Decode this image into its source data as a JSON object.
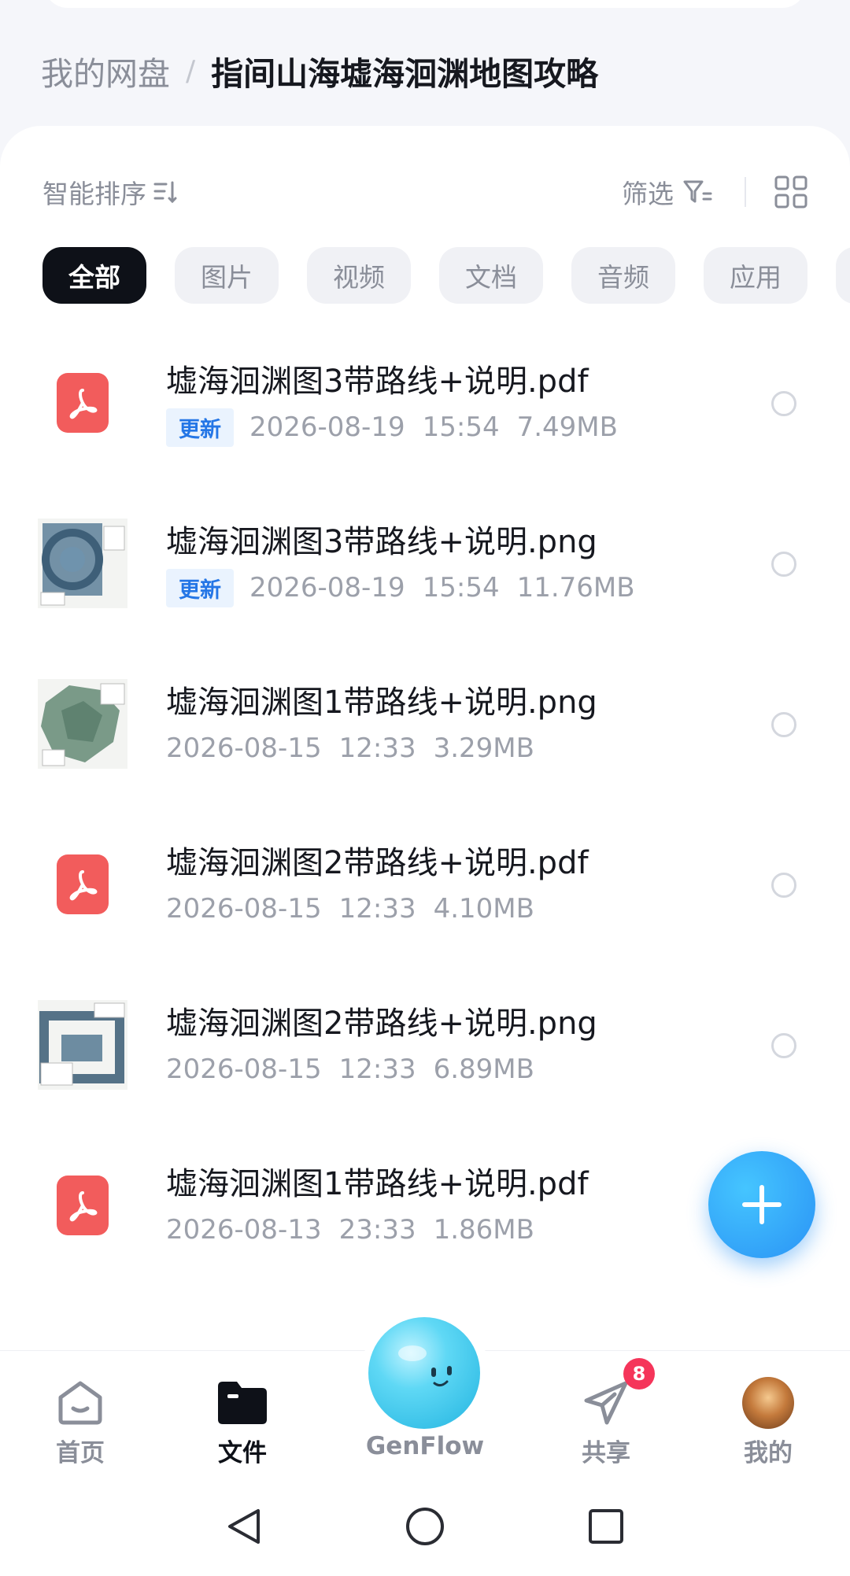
{
  "breadcrumb": {
    "root": "我的网盘",
    "separator": "/",
    "current": "指间山海墟海洄渊地图攻略"
  },
  "toolbar": {
    "sort_label": "智能排序",
    "filter_label": "筛选"
  },
  "tabs": [
    {
      "label": "全部",
      "active": true
    },
    {
      "label": "图片"
    },
    {
      "label": "视频"
    },
    {
      "label": "文档"
    },
    {
      "label": "音频"
    },
    {
      "label": "应用"
    }
  ],
  "files": [
    {
      "name": "墟海洄渊图3带路线+说明.pdf",
      "type": "pdf",
      "badge": "更新",
      "date": "2026-08-19",
      "time": "15:54",
      "size": "7.49MB"
    },
    {
      "name": "墟海洄渊图3带路线+说明.png",
      "type": "image",
      "badge": "更新",
      "date": "2026-08-19",
      "time": "15:54",
      "size": "11.76MB"
    },
    {
      "name": "墟海洄渊图1带路线+说明.png",
      "type": "image",
      "badge": "",
      "date": "2026-08-15",
      "time": "12:33",
      "size": "3.29MB"
    },
    {
      "name": "墟海洄渊图2带路线+说明.pdf",
      "type": "pdf",
      "badge": "",
      "date": "2026-08-15",
      "time": "12:33",
      "size": "4.10MB"
    },
    {
      "name": "墟海洄渊图2带路线+说明.png",
      "type": "image",
      "badge": "",
      "date": "2026-08-15",
      "time": "12:33",
      "size": "6.89MB"
    },
    {
      "name": "墟海洄渊图1带路线+说明.pdf",
      "type": "pdf",
      "badge": "",
      "date": "2026-08-13",
      "time": "23:33",
      "size": "1.86MB"
    }
  ],
  "bottom_nav": {
    "home": "首页",
    "files": "文件",
    "genflow": "GenFlow",
    "share": "共享",
    "share_badge": "8",
    "mine": "我的"
  },
  "colors": {
    "accent": "#2a93f5",
    "pdf": "#f25c5c",
    "badge_text": "#2476e6",
    "notification": "#f5355a"
  }
}
